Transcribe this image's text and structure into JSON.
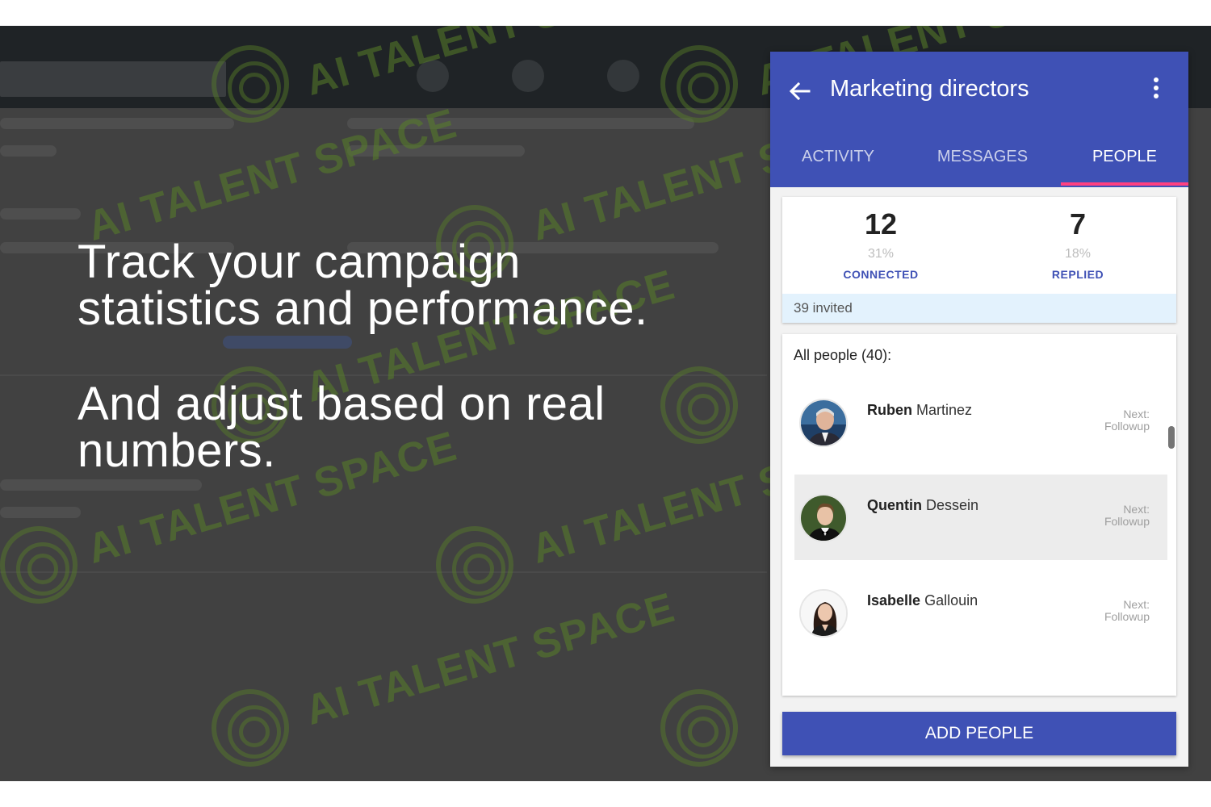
{
  "headline": {
    "line1a": "Track your campaign",
    "line1b": "statistics and performance.",
    "line2a": "And adjust based on real",
    "line2b": "numbers."
  },
  "watermark": {
    "text": "AI TALENT SPACE",
    "color": "#588028"
  },
  "card": {
    "title": "Marketing directors",
    "back_icon": "arrow-left-icon",
    "more_icon": "more-vertical-icon",
    "accent": "#3f51b5",
    "tab_indicator_color": "#ff4081",
    "tabs": [
      {
        "label": "ACTIVITY",
        "active": false
      },
      {
        "label": "MESSAGES",
        "active": false
      },
      {
        "label": "PEOPLE",
        "active": true
      }
    ],
    "stats": {
      "connected": {
        "value": "12",
        "percent": "31%",
        "label": "CONNECTED"
      },
      "replied": {
        "value": "7",
        "percent": "18%",
        "label": "REPLIED"
      },
      "invited": "39 invited"
    },
    "people": {
      "header": "All people (40):",
      "items": [
        {
          "first": "Ruben",
          "last": "Martinez",
          "next_label": "Next:",
          "next_value": "Followup",
          "highlighted": false
        },
        {
          "first": "Quentin",
          "last": "Dessein",
          "next_label": "Next:",
          "next_value": "Followup",
          "highlighted": true
        },
        {
          "first": "Isabelle",
          "last": "Gallouin",
          "next_label": "Next:",
          "next_value": "Followup",
          "highlighted": false
        }
      ]
    },
    "add_button": "ADD PEOPLE"
  }
}
